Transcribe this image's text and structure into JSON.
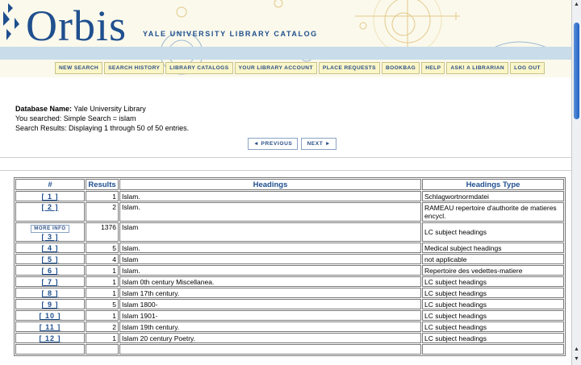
{
  "header": {
    "logo": "Orbis",
    "subtitle": "YALE UNIVERSITY LIBRARY CATALOG",
    "colors": {
      "logo": "#1f4f8e",
      "banner": "#fbf9ec",
      "band": "#c8dce9"
    }
  },
  "nav": [
    "NEW SEARCH",
    "SEARCH HISTORY",
    "LIBRARY CATALOGS",
    "YOUR LIBRARY ACCOUNT",
    "PLACE REQUESTS",
    "BOOKBAG",
    "HELP",
    "ASK! A LIBRARIAN",
    "LOG OUT"
  ],
  "info": {
    "db_label": "Database Name:",
    "db_value": "Yale University Library",
    "searched": "You searched: Simple Search = islam",
    "results": "Search Results: Displaying 1 through 50 of 50 entries."
  },
  "pager": {
    "previous": "◄ PREVIOUS",
    "next": "NEXT ►"
  },
  "table": {
    "headers": [
      "#",
      "Results",
      "Headings",
      "Headings Type"
    ],
    "more_info": "MORE INFO",
    "rows": [
      {
        "num": "[ 1 ]",
        "results": "1",
        "heading": "Islam.",
        "type": "Schlagwortnormdatei"
      },
      {
        "num": "[ 2 ]",
        "results": "2",
        "heading": "Islam.",
        "type": "RAMEAU repertoire d'authorite de matieres encycl."
      },
      {
        "num": "[ 3 ]",
        "results": "1376",
        "heading": "Islam",
        "type": "LC subject headings",
        "more_info": true
      },
      {
        "num": "[ 4 ]",
        "results": "5",
        "heading": "Islam.",
        "type": "Medical subject headings"
      },
      {
        "num": "[ 5 ]",
        "results": "4",
        "heading": "Islam",
        "type": "not applicable"
      },
      {
        "num": "[ 6 ]",
        "results": "1",
        "heading": "Islam.",
        "type": "Repertoire des vedettes-matiere"
      },
      {
        "num": "[ 7 ]",
        "results": "1",
        "heading": "Islam 0th century Miscellanea.",
        "type": "LC subject headings"
      },
      {
        "num": "[ 8 ]",
        "results": "1",
        "heading": "Islam 17th century.",
        "type": "LC subject headings"
      },
      {
        "num": "[ 9 ]",
        "results": "5",
        "heading": "Islam 1800-",
        "type": "LC subject headings"
      },
      {
        "num": "[ 10 ]",
        "results": "1",
        "heading": "Islam 1901-",
        "type": "LC subject headings"
      },
      {
        "num": "[ 11 ]",
        "results": "2",
        "heading": "Islam 19th century.",
        "type": "LC subject headings"
      },
      {
        "num": "[ 12 ]",
        "results": "1",
        "heading": "Islam 20 century Poetry.",
        "type": "LC subject headings"
      },
      {
        "num": "",
        "results": "",
        "heading": "",
        "type": ""
      }
    ]
  },
  "scrollbar": {
    "up": "▲",
    "down": "▼"
  }
}
